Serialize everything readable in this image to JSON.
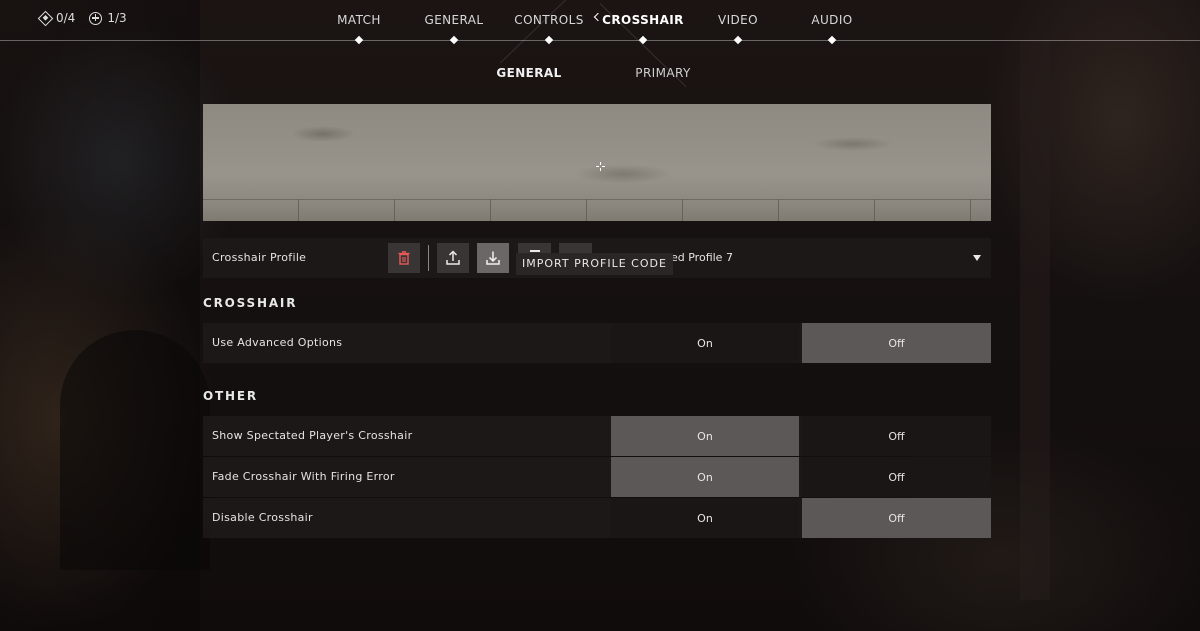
{
  "counters": [
    {
      "icon": "diamond-icon",
      "value": "0/4"
    },
    {
      "icon": "plus-circle-icon",
      "value": "1/3"
    }
  ],
  "tabs": [
    {
      "label": "MATCH",
      "active": false
    },
    {
      "label": "GENERAL",
      "active": false
    },
    {
      "label": "CONTROLS",
      "active": false
    },
    {
      "label": "CROSSHAIR",
      "active": true
    },
    {
      "label": "VIDEO",
      "active": false
    },
    {
      "label": "AUDIO",
      "active": false
    }
  ],
  "subtabs": [
    {
      "label": "GENERAL",
      "active": true
    },
    {
      "label": "PRIMARY",
      "active": false
    }
  ],
  "profile": {
    "label": "Crosshair Profile",
    "value_visible": "ed Profile 7",
    "buttons": [
      "trash-icon",
      "export-icon",
      "import-icon",
      "icon-4",
      "icon-5"
    ],
    "tooltip": "IMPORT PROFILE CODE"
  },
  "sections": {
    "crosshair": {
      "title": "CROSSHAIR",
      "rows": [
        {
          "label": "Use Advanced Options",
          "on": "On",
          "off": "Off",
          "selected": "off"
        }
      ]
    },
    "other": {
      "title": "OTHER",
      "rows": [
        {
          "label": "Show Spectated Player's Crosshair",
          "on": "On",
          "off": "Off",
          "selected": "on"
        },
        {
          "label": "Fade Crosshair With Firing Error",
          "on": "On",
          "off": "Off",
          "selected": "on"
        },
        {
          "label": "Disable Crosshair",
          "on": "On",
          "off": "Off",
          "selected": "off"
        }
      ]
    }
  },
  "colors": {
    "selected_option": "#5c5858",
    "row_background": "#1e1a1a",
    "preview_wall": "#99948b",
    "crosshair": "#ffffff"
  }
}
